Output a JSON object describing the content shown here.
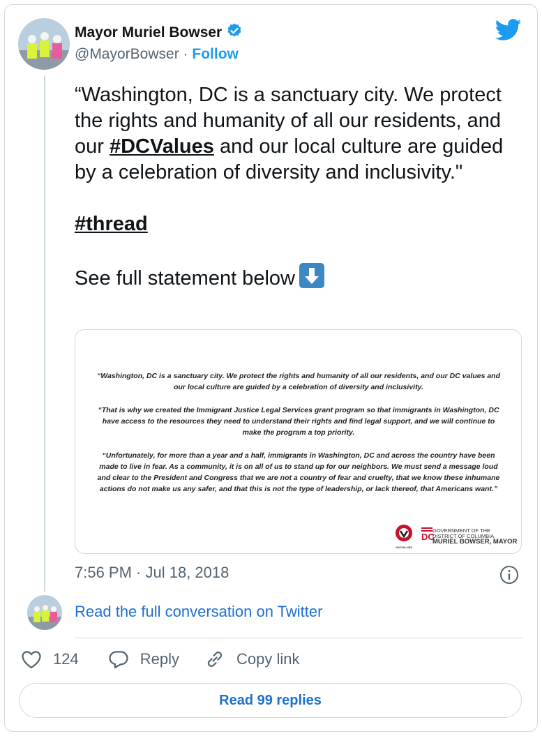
{
  "author": {
    "name": "Mayor Muriel Bowser",
    "handle": "@MayorBowser",
    "separator": "·",
    "follow_label": "Follow"
  },
  "tweet": {
    "line1_pre": "“Washington, DC is a sanctuary city. We protect the rights and humanity of all our residents, and our ",
    "hashtag1": "#DCValues",
    "line1_post": " and our local culture are guided by a celebration of diversity and inclusivity.\"",
    "hashtag2": "#thread",
    "line3": "See full statement below",
    "emoji": "down-arrow-icon"
  },
  "media": {
    "para1": "“Washington, DC is a sanctuary city. We protect the rights and humanity of all our residents, and our DC values and our local culture are guided by a celebration of diversity and inclusivity.",
    "para2": "“That is why we created the Immigrant Justice Legal Services grant program so that immigrants in Washington, DC have access to the resources they need to understand their rights and find legal support, and we will continue to make the program a top priority.",
    "para3": "“Unfortunately, for more than a year and a half, immigrants in Washington, DC and across the country have been made to live in fear. As a community, it is on all of us to stand up for our neighbors. We must send a message loud and clear to the President and Congress that we are not a country of fear and cruelty, that we know these inhumane actions do not make us any safer, and that this is not the type of leadership, or lack thereof, that Americans want.”",
    "logo_caption": "#DCVALUES",
    "gov_line1": "GOVERNMENT OF THE",
    "gov_line2": "DISTRICT OF COLUMBIA",
    "gov_line3": "MURIEL BOWSER, MAYOR",
    "gov_mark": "DC"
  },
  "timestamp": "7:56 PM · Jul 18, 2018",
  "conversation_link": "Read the full conversation on Twitter",
  "actions": {
    "likes": "124",
    "reply_label": "Reply",
    "copy_label": "Copy link"
  },
  "read_replies": "Read 99 replies",
  "colors": {
    "accent": "#1d9bf0",
    "link": "#1d6fcf",
    "muted": "#536471",
    "border": "#cfd9de"
  }
}
